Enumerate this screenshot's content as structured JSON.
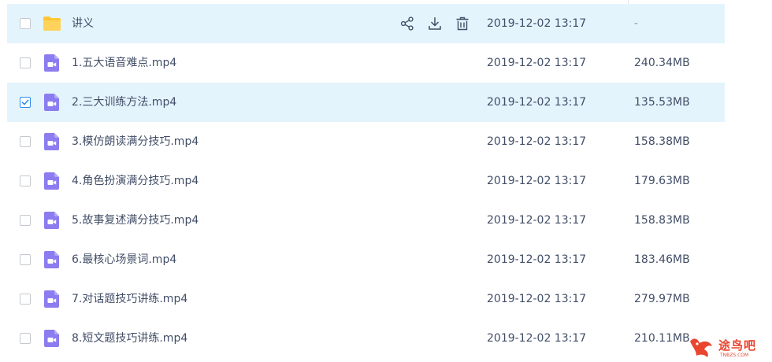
{
  "files": [
    {
      "name": "讲义",
      "type": "folder",
      "date": "2019-12-02 13:17",
      "size": "-",
      "checked": false,
      "hover": true
    },
    {
      "name": "1.五大语音难点.mp4",
      "type": "video",
      "date": "2019-12-02 13:17",
      "size": "240.34MB",
      "checked": false
    },
    {
      "name": "2.三大训练方法.mp4",
      "type": "video",
      "date": "2019-12-02 13:17",
      "size": "135.53MB",
      "checked": true
    },
    {
      "name": "3.模仿朗读满分技巧.mp4",
      "type": "video",
      "date": "2019-12-02 13:17",
      "size": "158.38MB",
      "checked": false
    },
    {
      "name": "4.角色扮演满分技巧.mp4",
      "type": "video",
      "date": "2019-12-02 13:17",
      "size": "179.63MB",
      "checked": false
    },
    {
      "name": "5.故事复述满分技巧.mp4",
      "type": "video",
      "date": "2019-12-02 13:17",
      "size": "158.83MB",
      "checked": false
    },
    {
      "name": "6.最核心场景词.mp4",
      "type": "video",
      "date": "2019-12-02 13:17",
      "size": "183.46MB",
      "checked": false
    },
    {
      "name": "7.对话题技巧讲练.mp4",
      "type": "video",
      "date": "2019-12-02 13:17",
      "size": "279.97MB",
      "checked": false
    },
    {
      "name": "8.短文题技巧讲练.mp4",
      "type": "video",
      "date": "2019-12-02 13:17",
      "size": "210.11MB",
      "checked": false
    }
  ],
  "row_actions": [
    "share-icon",
    "download-icon",
    "delete-icon"
  ],
  "watermark": {
    "text": "途鸟吧",
    "sub": "TNBZS.COM"
  },
  "colors": {
    "row_highlight": "#e4f4fd",
    "checkbox_checked": "#2d8cf0",
    "video_icon": "#8b7cf0",
    "folder_icon": "#ffc633",
    "text": "#424e67",
    "watermark": "#e9452f"
  }
}
